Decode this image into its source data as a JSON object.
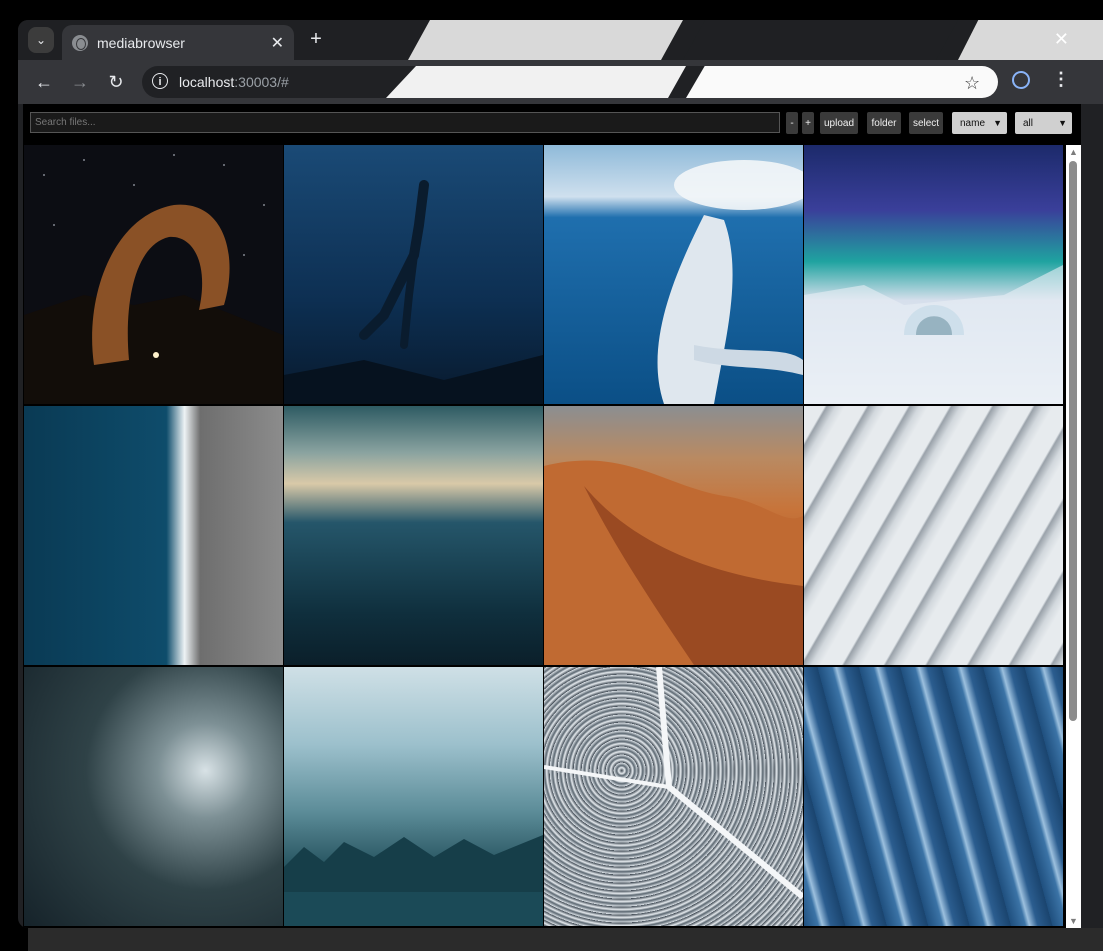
{
  "browser": {
    "tab_title": "mediabrowser",
    "tab_close": "✕",
    "new_tab": "+",
    "window_close": "✕",
    "url_host": "localhost",
    "url_path": ":30003/#"
  },
  "toolbar": {
    "search_placeholder": "Search files...",
    "zoom_out_label": "-",
    "zoom_in_label": "+",
    "upload_label": "upload",
    "folder_label": "folder",
    "select_label": "select",
    "sort_value": "name",
    "filter_value": "all"
  },
  "gallery": {
    "images": [
      {
        "subject": "arch-under-milky-way"
      },
      {
        "subject": "underwater-diver"
      },
      {
        "subject": "humpback-whale-breaching"
      },
      {
        "subject": "aurora-over-ice-hotel"
      },
      {
        "subject": "aerial-black-sand-beach"
      },
      {
        "subject": "aerial-ocean-waves"
      },
      {
        "subject": "desert-dunes-caravan"
      },
      {
        "subject": "glacier-crevasses"
      },
      {
        "subject": "storm-clouds"
      },
      {
        "subject": "misty-snowy-forest-lake"
      },
      {
        "subject": "aerial-snowy-forest"
      },
      {
        "subject": "blue-ice-ridges"
      }
    ]
  },
  "colors": {
    "page_background": "#000000",
    "button_background": "#3a3a3a",
    "select_background": "#d0d0d0"
  }
}
